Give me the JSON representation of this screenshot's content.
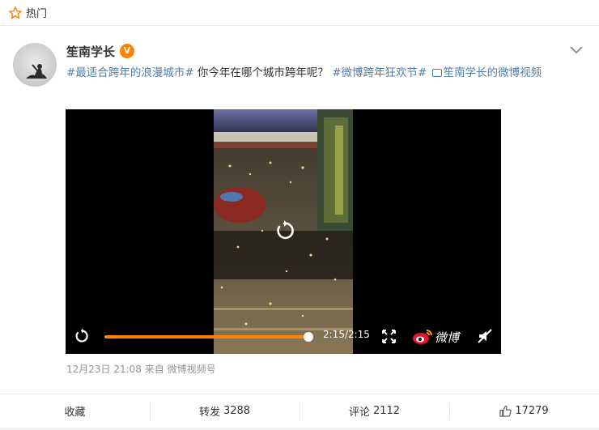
{
  "header": {
    "label": "热门"
  },
  "post": {
    "author": "笙南学长",
    "text": {
      "tag1": "#最适合跨年的浪漫城市#",
      "question": " 你今年在哪个城市跨年呢？ ",
      "tag2": "#微博跨年狂欢节#",
      "video_link": "笙南学长的微博视频"
    },
    "meta": "12月23日 21:08  来自 微博视频号"
  },
  "video": {
    "time": "2:15/2:15",
    "progress": 1.0,
    "brand": "微博"
  },
  "footer": {
    "collect": "收藏",
    "repost_label": "转发",
    "repost_count": "3288",
    "comment_label": "评论",
    "comment_count": "2112",
    "like_count": "17279"
  },
  "colors": {
    "accent": "#ff8200",
    "link": "#507daf",
    "muted": "#939393"
  }
}
